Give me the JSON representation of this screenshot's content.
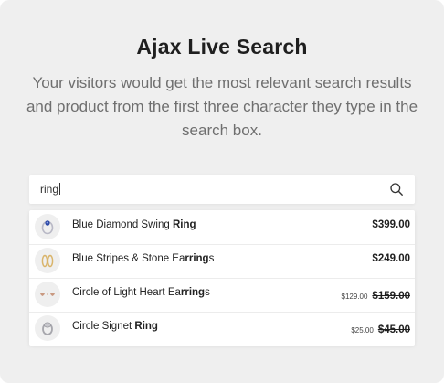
{
  "header": {
    "title": "Ajax Live Search",
    "subtitle": "Your visitors would get the most relevant search results and product from the first three character they type in the search box."
  },
  "search": {
    "value": "ring",
    "icon": "search-icon"
  },
  "results": [
    {
      "name_prefix": "Blue Diamond Swing ",
      "name_match": "Ring",
      "name_suffix": "",
      "price": "$399.00",
      "thumb_icon": "blue-diamond-ring-icon"
    },
    {
      "name_prefix": "Blue Stripes & Stone Ea",
      "name_match": "rring",
      "name_suffix": "s",
      "price": "$249.00",
      "thumb_icon": "gold-hoop-earrings-icon"
    },
    {
      "name_prefix": "Circle of Light Heart Ea",
      "name_match": "rring",
      "name_suffix": "s",
      "sale_price": "$129.00",
      "original_price": "$159.00",
      "thumb_icon": "heart-earrings-icon"
    },
    {
      "name_prefix": "Circle Signet ",
      "name_match": "Ring",
      "name_suffix": "",
      "sale_price": "$25.00",
      "original_price": "$45.00",
      "thumb_icon": "silver-signet-ring-icon"
    }
  ],
  "colors": {
    "background": "#efefef",
    "title": "#1f1f1f",
    "subtitle": "#6f6f6f",
    "card": "#ffffff"
  }
}
